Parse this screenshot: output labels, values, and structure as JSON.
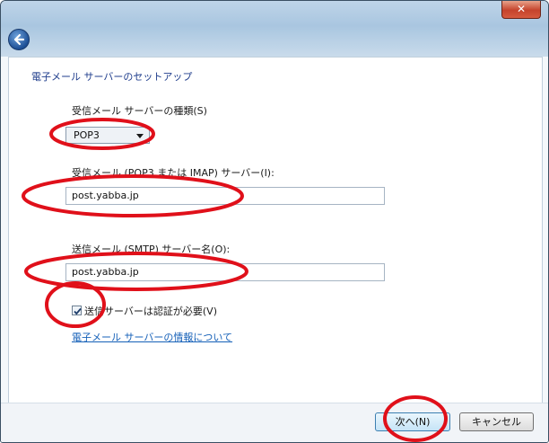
{
  "window": {
    "close_label": "✕"
  },
  "page": {
    "heading": "電子メール サーバーのセットアップ"
  },
  "incoming_type": {
    "label": "受信メール サーバーの種類(S)",
    "selected": "POP3"
  },
  "incoming_server": {
    "label": "受信メール (POP3 または IMAP) サーバー(I):",
    "value": "post.yabba.jp"
  },
  "outgoing_server": {
    "label": "送信メール (SMTP) サーバー名(O):",
    "value": "post.yabba.jp"
  },
  "auth": {
    "label": "送信サーバーは認証が必要(V)",
    "checked": true
  },
  "info_link": "電子メール サーバーの情報について",
  "buttons": {
    "next": "次へ(N)",
    "cancel": "キャンセル"
  },
  "annotation_color": "#e0101a"
}
